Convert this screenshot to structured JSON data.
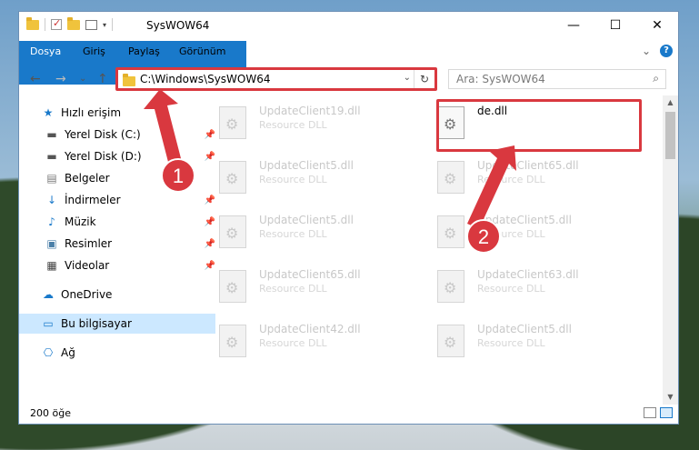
{
  "window": {
    "title": "SysWOW64"
  },
  "window_buttons": {
    "minimize": "—",
    "maximize": "☐",
    "close": "✕"
  },
  "ribbon": {
    "tabs": [
      "Dosya",
      "Giriş",
      "Paylaş",
      "Görünüm"
    ],
    "help": "?",
    "expand": "⌄"
  },
  "nav": {
    "back": "←",
    "forward": "→",
    "recent": "⌄",
    "up": "↑",
    "address": "C:\\Windows\\SysWOW64",
    "address_dropdown": "⌄",
    "refresh": "↻",
    "search_placeholder": "Ara: SysWOW64",
    "search_icon": "⌕"
  },
  "sidebar": {
    "items": [
      {
        "label": "Hızlı erişim",
        "icon": "★"
      },
      {
        "label": "Yerel Disk (C:)",
        "icon": "▬"
      },
      {
        "label": "Yerel Disk (D:)",
        "icon": "▬"
      },
      {
        "label": "Belgeler",
        "icon": "▤"
      },
      {
        "label": "İndirmeler",
        "icon": "↓"
      },
      {
        "label": "Müzik",
        "icon": "♪"
      },
      {
        "label": "Resimler",
        "icon": "▣"
      },
      {
        "label": "Videolar",
        "icon": "▦"
      },
      {
        "label": "OneDrive",
        "icon": "☁"
      },
      {
        "label": "Bu bilgisayar",
        "icon": "▭"
      },
      {
        "label": "Ağ",
        "icon": "⎔"
      }
    ],
    "pin": "📌"
  },
  "files": [
    {
      "name": "UpdateClient19.dll",
      "type": "Resource DLL"
    },
    {
      "name": "de.dll",
      "type": ""
    },
    {
      "name": "UpdateClient5.dll",
      "type": "Resource DLL"
    },
    {
      "name": "UpdateClient65.dll",
      "type": "Resource DLL"
    },
    {
      "name": "UpdateClient5.dll",
      "type": "Resource DLL"
    },
    {
      "name": "UpdateClient5.dll",
      "type": "Resource DLL"
    },
    {
      "name": "UpdateClient65.dll",
      "type": "Resource DLL"
    },
    {
      "name": "UpdateClient63.dll",
      "type": "Resource DLL"
    },
    {
      "name": "UpdateClient42.dll",
      "type": "Resource DLL"
    },
    {
      "name": "UpdateClient5.dll",
      "type": "Resource DLL"
    }
  ],
  "annotations": {
    "step1": "1",
    "step2": "2"
  },
  "status": {
    "item_count": "200 öğe"
  },
  "colors": {
    "accent": "#1979ca",
    "highlight": "#d9383f",
    "selected_nav": "#cce8ff"
  }
}
